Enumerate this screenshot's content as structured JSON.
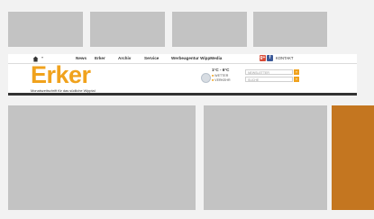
{
  "nav": {
    "items": [
      "News",
      "Erker",
      "Archiv",
      "Service",
      "Werbeagentur WippMedia"
    ],
    "contact": "KONTAKT"
  },
  "brand": {
    "logo": "Erker",
    "tagline": "Monatszeitschrift für das südliche Wipptal",
    "accent_color": "#f0a21d"
  },
  "weather": {
    "temp": "1°C - 6°C",
    "links": [
      "WETTER",
      "VERKEHR"
    ]
  },
  "search": {
    "field1_placeholder": "NEWSLETTER",
    "field2_placeholder": "SUCHE",
    "go_label": "»"
  },
  "social": [
    "g+",
    "f"
  ],
  "colors": {
    "background": "#f2f2f2",
    "placeholder": "#c3c3c3",
    "sidebar": "#c47620"
  }
}
